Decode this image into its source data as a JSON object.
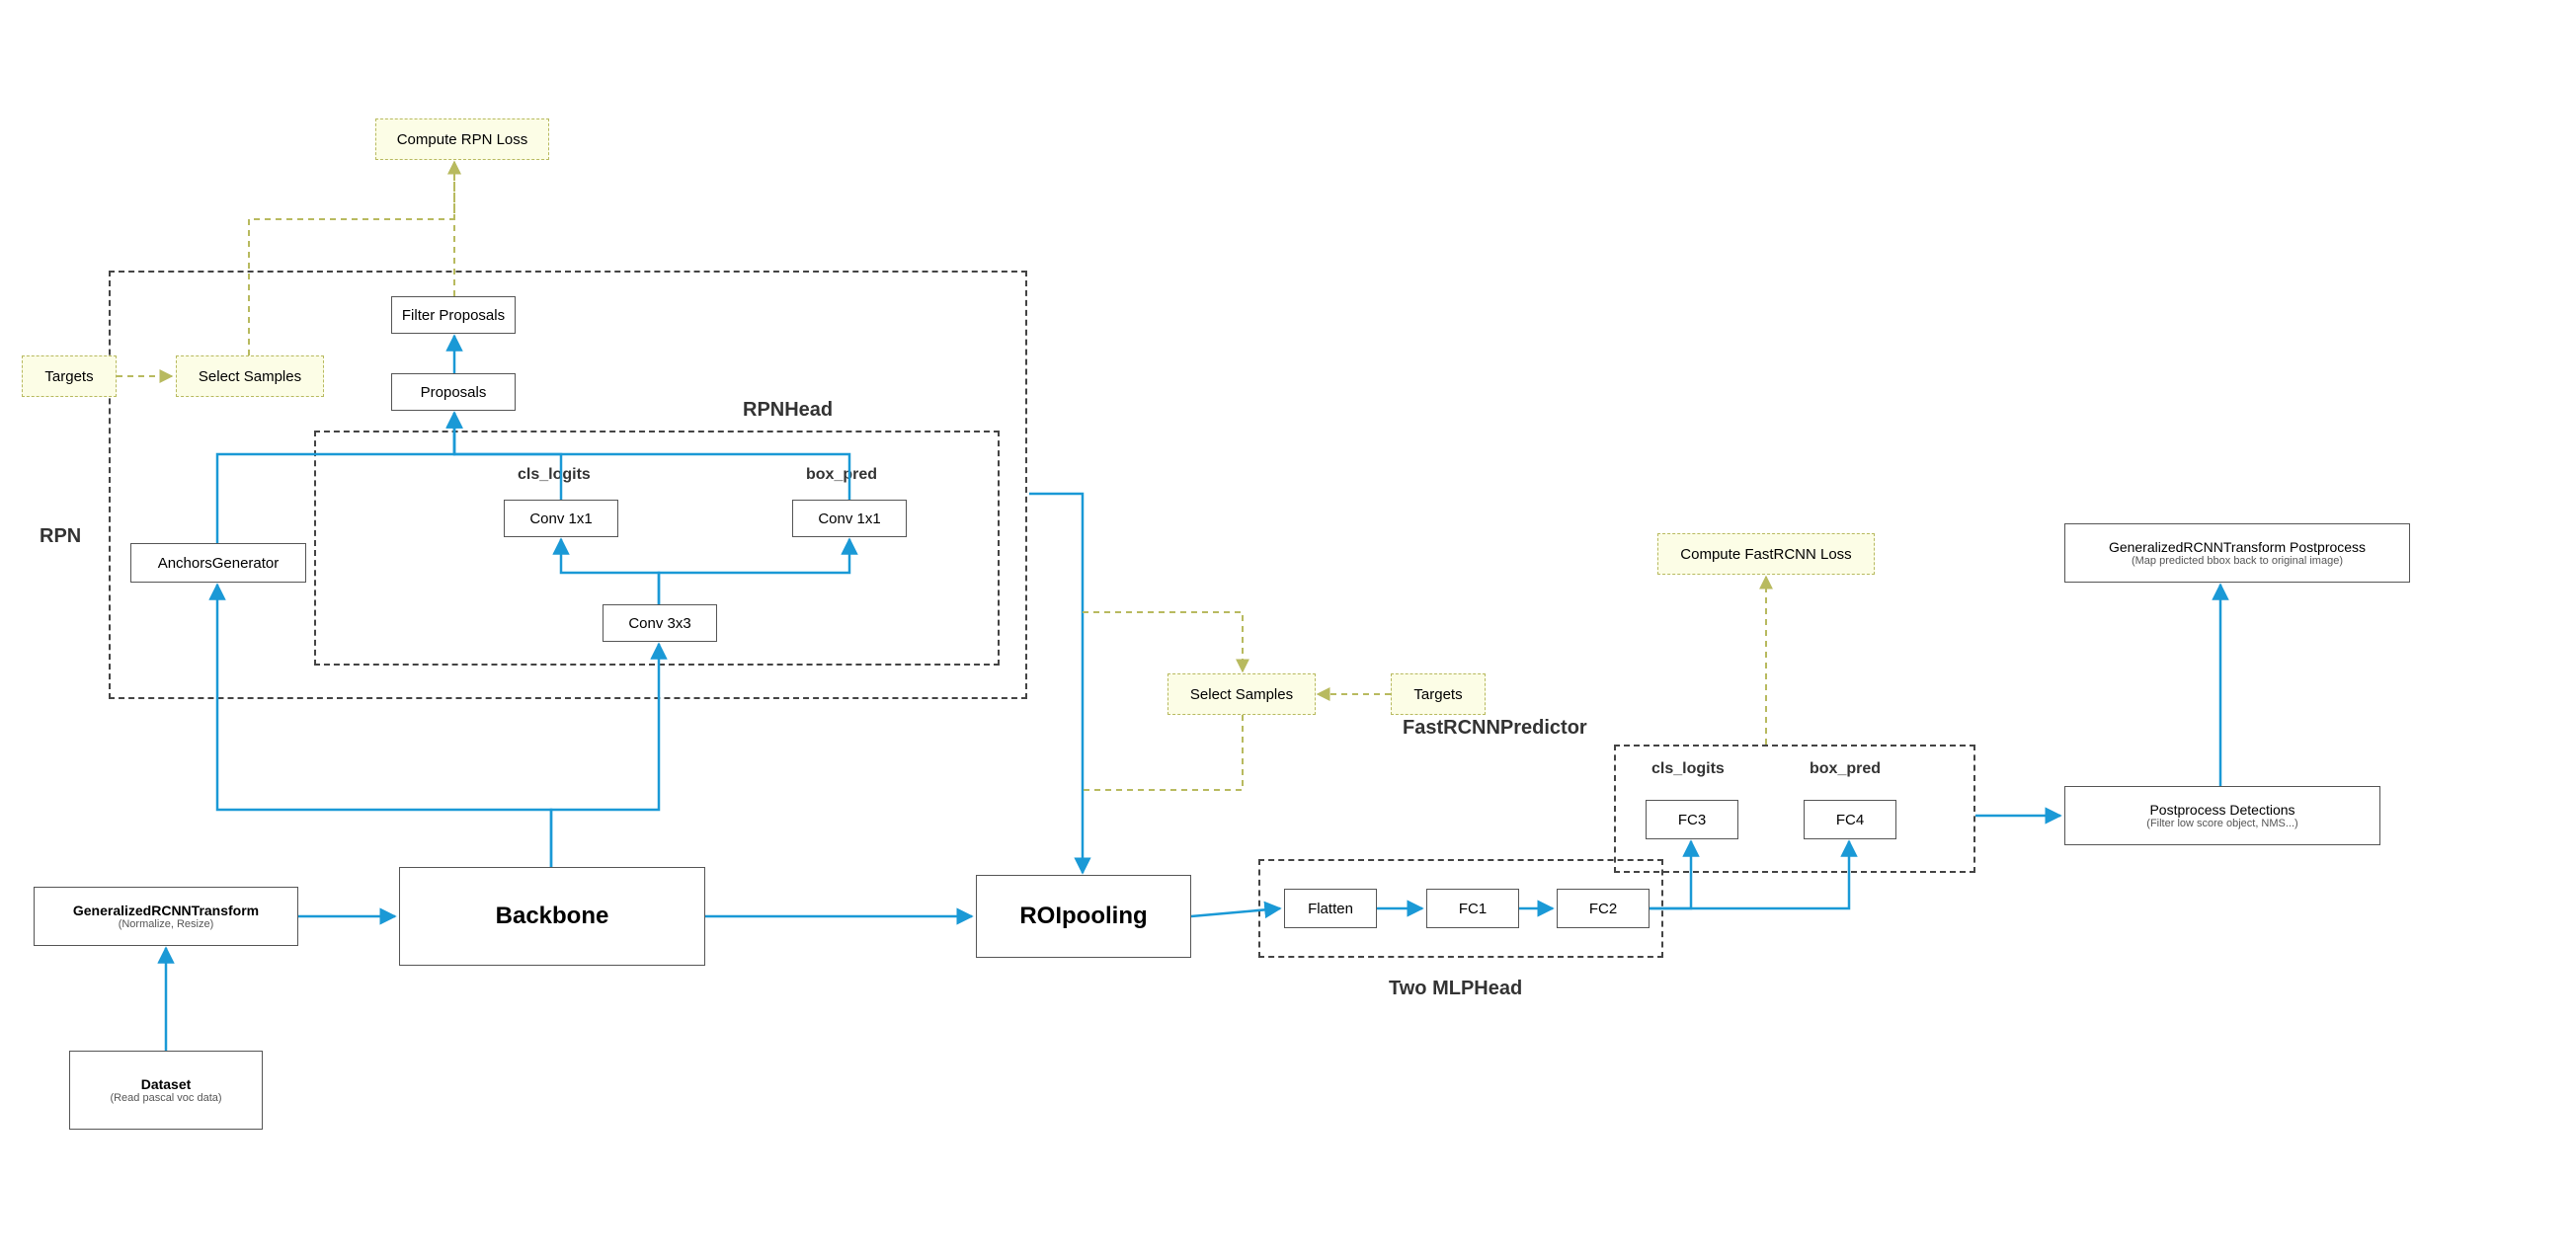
{
  "nodes": {
    "dataset": {
      "title": "Dataset",
      "sub": "(Read pascal voc data)"
    },
    "transform": {
      "title": "GeneralizedRCNNTransform",
      "sub": "(Normalize, Resize)"
    },
    "backbone": "Backbone",
    "roipooling": "ROIpooling",
    "anchors": "AnchorsGenerator",
    "proposals": "Proposals",
    "filter_proposals": "Filter Proposals",
    "conv3x3": "Conv 3x3",
    "conv1x1_cls": "Conv 1x1",
    "conv1x1_box": "Conv 1x1",
    "cls_logits": "cls_logits",
    "box_pred": "box_pred",
    "flatten": "Flatten",
    "fc1": "FC1",
    "fc2": "FC2",
    "fc3": "FC3",
    "fc4": "FC4",
    "pred_cls_logits": "cls_logits",
    "pred_box_pred": "box_pred",
    "postprocess_det": {
      "title": "Postprocess Detections",
      "sub": "(Filter low score object,   NMS...)"
    },
    "postprocess_final": {
      "title": "GeneralizedRCNNTransform    Postprocess",
      "sub": "(Map predicted bbox back to original image)"
    }
  },
  "ynodes": {
    "targets1": "Targets",
    "select_samples1": "Select Samples",
    "compute_rpn_loss": "Compute RPN Loss",
    "select_samples2": "Select Samples",
    "targets2": "Targets",
    "compute_fastrcnn_loss": "Compute FastRCNN Loss"
  },
  "labels": {
    "rpn": "RPN",
    "rpnhead": "RPNHead",
    "two_mlphead": "Two MLPHead",
    "fastrcnn_predictor": "FastRCNNPredictor"
  }
}
